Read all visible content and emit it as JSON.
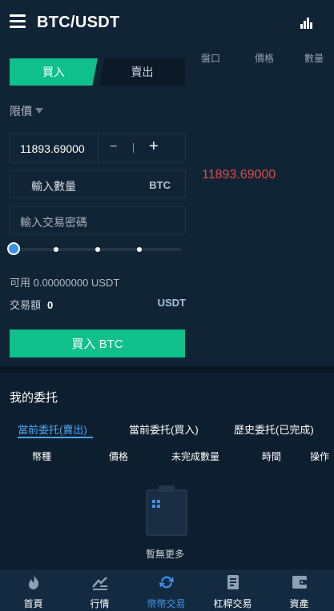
{
  "header": {
    "title": "BTC/USDT",
    "menu_icon": "hamburger-menu-icon",
    "chart_icon": "bar-chart-icon"
  },
  "trade": {
    "tabs": {
      "buy": "買入",
      "sell": "賣出"
    },
    "order_type": "限價",
    "price_value": "11893.69000",
    "minus": "−",
    "plus": "+",
    "qty_label": "輸入數量",
    "qty_unit": "BTC",
    "password_placeholder": "輸入交易密碼",
    "slider_level": 0,
    "available_label": "可用 0.00000000  USDT",
    "amount_label": "交易額",
    "amount_value": "0",
    "amount_unit": "USDT",
    "submit_label": "買入 BTC"
  },
  "orderbook": {
    "headers": [
      "盤口",
      "價格",
      "數量"
    ],
    "last_price": "11893.69000",
    "last_price_color": "#e04a4a"
  },
  "orders": {
    "title": "我的委托",
    "tabs": [
      "當前委托(賣出)",
      "當前委托(買入)",
      "歷史委托(已完成)"
    ],
    "active_tab": 0,
    "columns": [
      "幣種",
      "價格",
      "未完成數量",
      "時間",
      "操作"
    ],
    "empty_text": "暫無更多",
    "empty_icon": "empty-clipboard-icon"
  },
  "nav": {
    "items": [
      {
        "label": "首頁",
        "icon": "flame-icon"
      },
      {
        "label": "行情",
        "icon": "market-chart-icon"
      },
      {
        "label": "幣幣交易",
        "icon": "exchange-refresh-icon"
      },
      {
        "label": "杠桿交易",
        "icon": "leverage-document-icon"
      },
      {
        "label": "資產",
        "icon": "wallet-icon"
      }
    ],
    "active": 2
  },
  "colors": {
    "accent_green": "#0fc08a",
    "accent_blue": "#3a91e8",
    "background": "#0d1e2e",
    "panel": "#112436"
  }
}
